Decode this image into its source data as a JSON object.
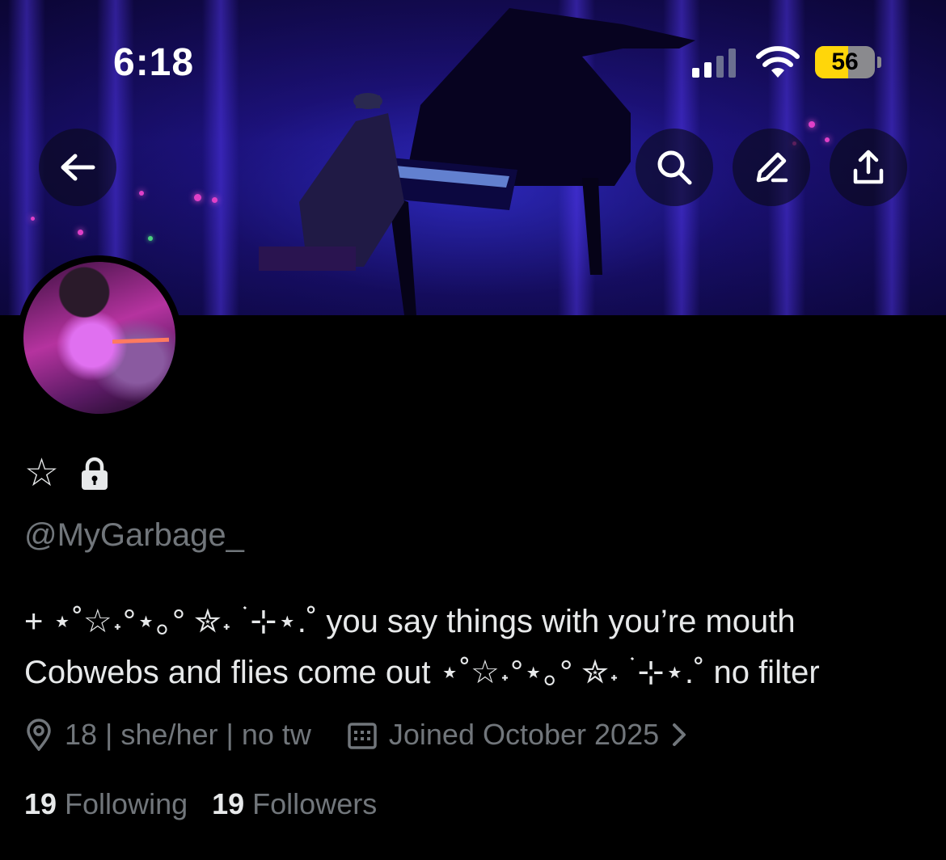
{
  "status_bar": {
    "time": "6:18",
    "battery": "56",
    "battery_level": 0.56,
    "signal_bars_active": 2,
    "signal_bars_total": 4
  },
  "header": {
    "back_icon": "arrow-left-icon",
    "actions": [
      "search-icon",
      "edit-icon",
      "share-icon"
    ]
  },
  "profile": {
    "display_name": "☆",
    "protected_icon": "lock-icon",
    "handle": "@MyGarbage_",
    "bio_line1": "+ ⋆˚☆˖°⋆｡° ✮˖ ࣪ ⊹⋆.˚ you say things with you’re mouth",
    "bio_line2": "Cobwebs and flies come out ⋆˚☆˖°⋆｡° ✮˖ ࣪ ⊹⋆.˚ no filter",
    "location": "18 | she/her | no tw",
    "joined": "Joined October 2025",
    "following_count": "19",
    "following_label": "Following",
    "followers_count": "19",
    "followers_label": "Followers"
  },
  "colors": {
    "background": "#000000",
    "text_primary": "#e7e9ea",
    "text_secondary": "#71767b",
    "battery_accent": "#ffd60a"
  }
}
